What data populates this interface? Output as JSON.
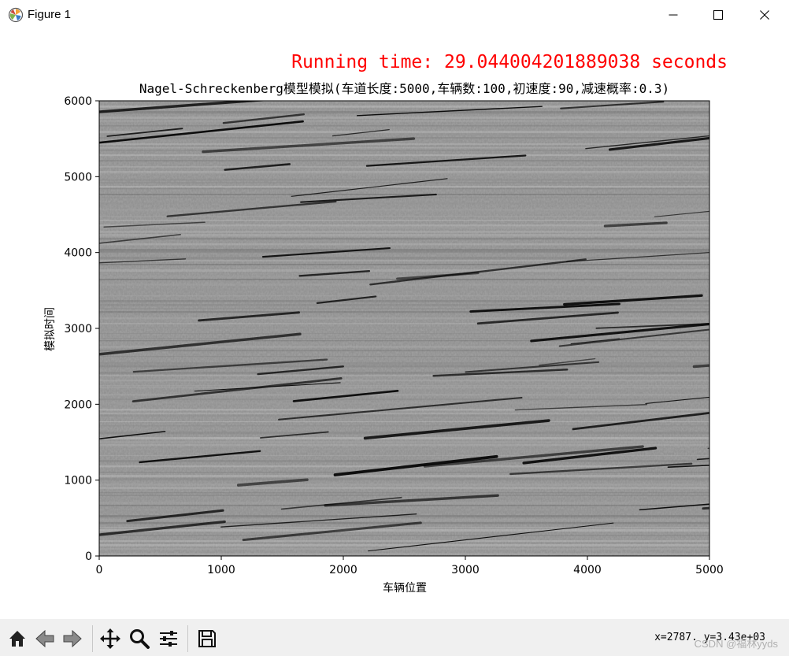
{
  "window": {
    "title": "Figure 1",
    "icons": {
      "app": "matplotlib-icon",
      "minimize": "minimize-icon",
      "maximize": "maximize-icon",
      "close": "close-icon"
    }
  },
  "figure": {
    "runtime_text": "Running time: 29.044004201889038 seconds",
    "runtime_color": "#ff0000",
    "title": "Nagel-Schreckenberg模型模拟(车道长度:5000,车辆数:100,初速度:90,减速概率:0.3)",
    "image_description_colormap": "gray",
    "chart_data": {
      "type": "heatmap",
      "title": "Nagel-Schreckenberg模型模拟(车道长度:5000,车辆数:100,初速度:90,减速概率:0.3)",
      "xlabel": "车辆位置",
      "ylabel": "模拟时间",
      "xlim": [
        0,
        5000
      ],
      "ylim": [
        0,
        6000
      ],
      "xticks": [
        0,
        1000,
        2000,
        3000,
        4000,
        5000
      ],
      "yticks": [
        0,
        1000,
        2000,
        3000,
        4000,
        5000,
        6000
      ],
      "colormap": "gray",
      "grid": false
    }
  },
  "toolbar": {
    "buttons": [
      {
        "name": "home-button",
        "icon": "home-icon"
      },
      {
        "name": "back-button",
        "icon": "back-arrow-icon"
      },
      {
        "name": "forward-button",
        "icon": "forward-arrow-icon"
      },
      {
        "name": "pan-button",
        "icon": "pan-move-icon"
      },
      {
        "name": "zoom-button",
        "icon": "zoom-magnifier-icon"
      },
      {
        "name": "configure-subplots-button",
        "icon": "sliders-icon"
      },
      {
        "name": "save-button",
        "icon": "save-disk-icon"
      }
    ],
    "coords": "x=2787. y=3.43e+03",
    "watermark": "CSDN @福林yyds"
  }
}
